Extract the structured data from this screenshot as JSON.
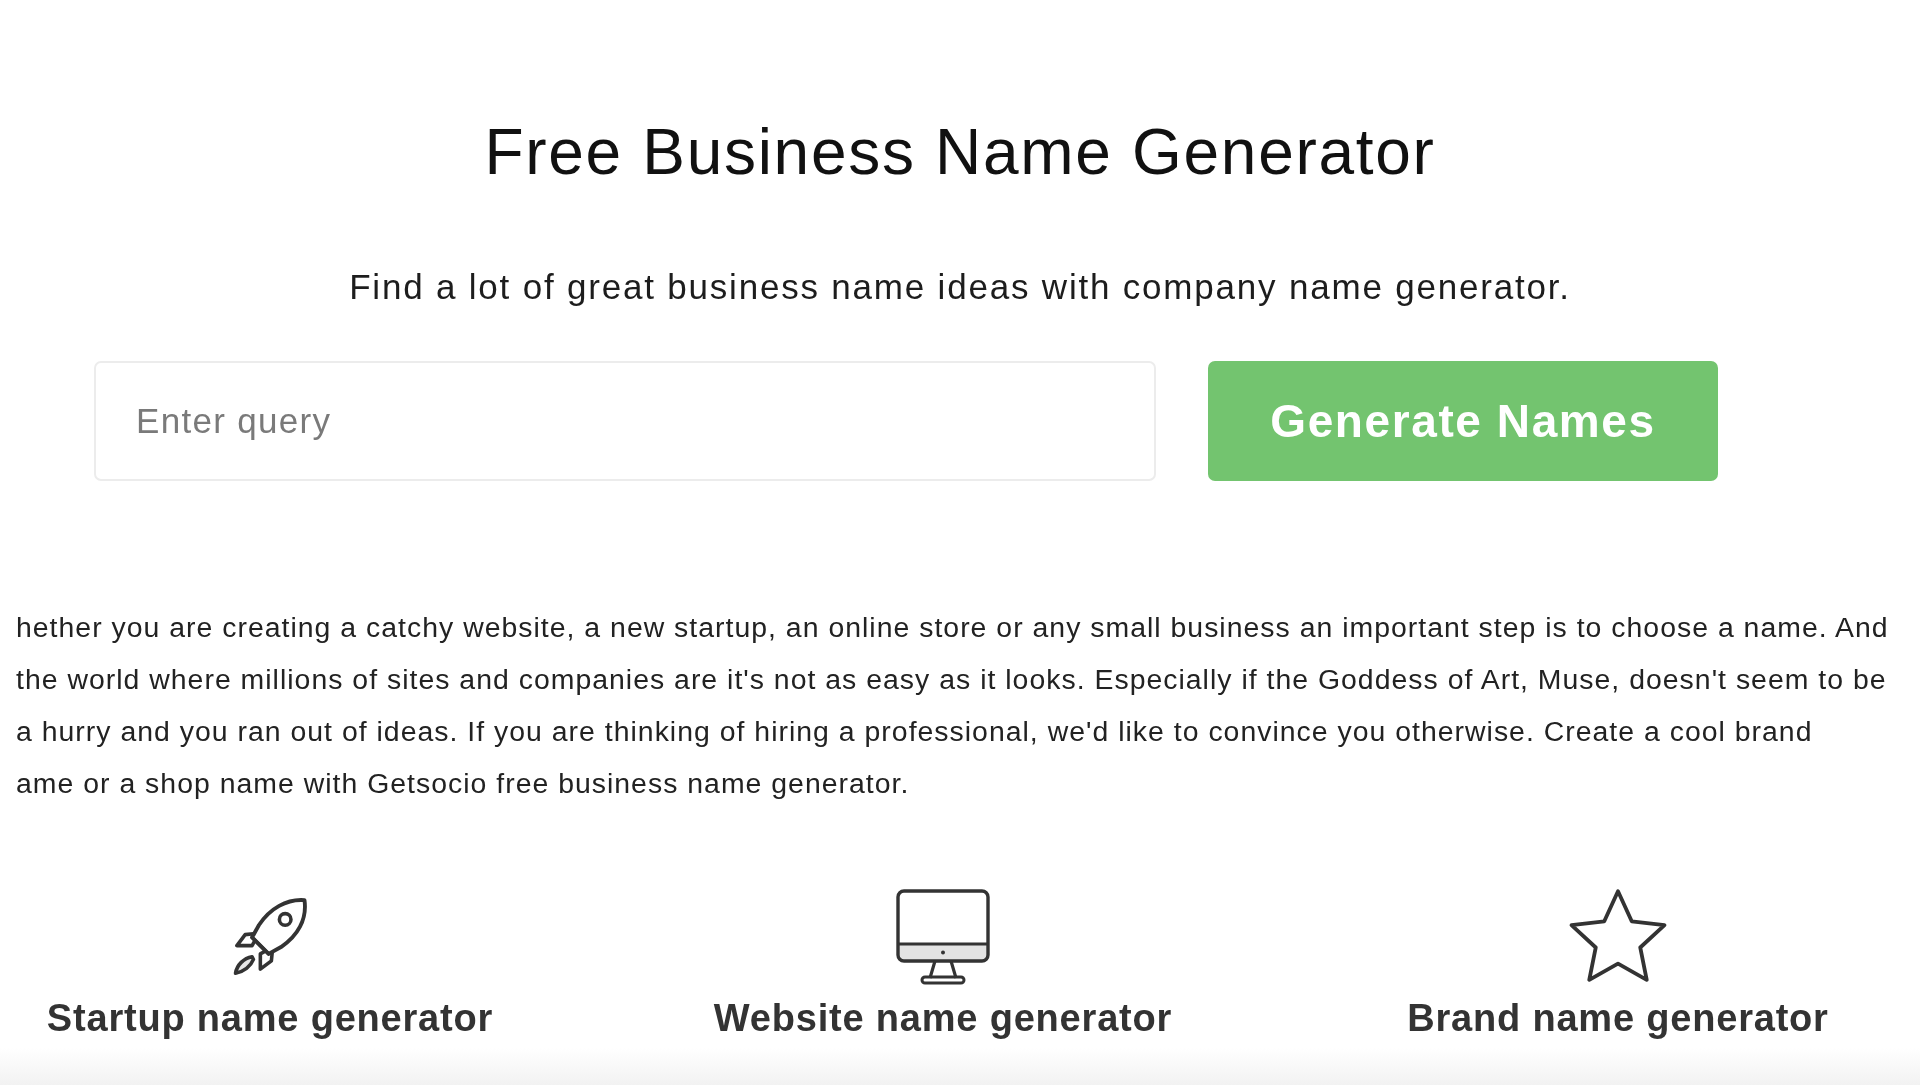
{
  "title": "Free Business Name Generator",
  "subtitle": "Find a lot of great business name ideas with company name generator.",
  "search": {
    "placeholder": "Enter query",
    "button": "Generate Names"
  },
  "intro_paragraph": {
    "lines": [
      "hether you are creating a catchy website, a new startup, an online store or any small business an important step is to choose a name. And",
      "the world where millions of sites and companies are it's not as easy as it looks. Especially if the Goddess of Art, Muse, doesn't seem to be",
      "a hurry and you ran out of ideas. If you are thinking of hiring a professional, we'd like to convince you otherwise. Create a cool brand",
      "ame or a shop name with Getsocio free business name generator."
    ]
  },
  "features": [
    {
      "kind": "rocket",
      "label": "Startup name generator"
    },
    {
      "kind": "monitor",
      "label": "Website name generator"
    },
    {
      "kind": "star",
      "label": "Brand name generator"
    }
  ]
}
